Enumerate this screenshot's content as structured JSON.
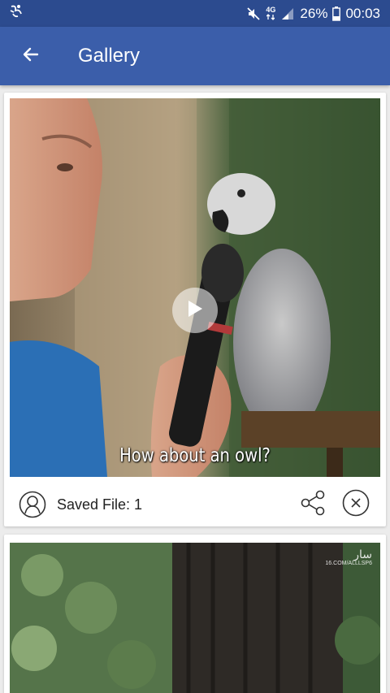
{
  "status_bar": {
    "battery": "26%",
    "time": "00:03",
    "network": "4G"
  },
  "app_bar": {
    "title": "Gallery",
    "back_icon": "arrow-left-icon"
  },
  "items": [
    {
      "caption": "How about an owl?",
      "saved_label": "Saved File: 1",
      "play_icon": "play-icon",
      "share_icon": "share-icon",
      "close_icon": "close-circle-icon",
      "avatar_icon": "user-outline-icon"
    },
    {
      "watermark": "سار",
      "watermark_sub": "16.COM/ALLLSP6"
    }
  ],
  "colors": {
    "status_bar": "#2c4b8f",
    "app_bar": "#3b5eaa",
    "background": "#ececec"
  }
}
